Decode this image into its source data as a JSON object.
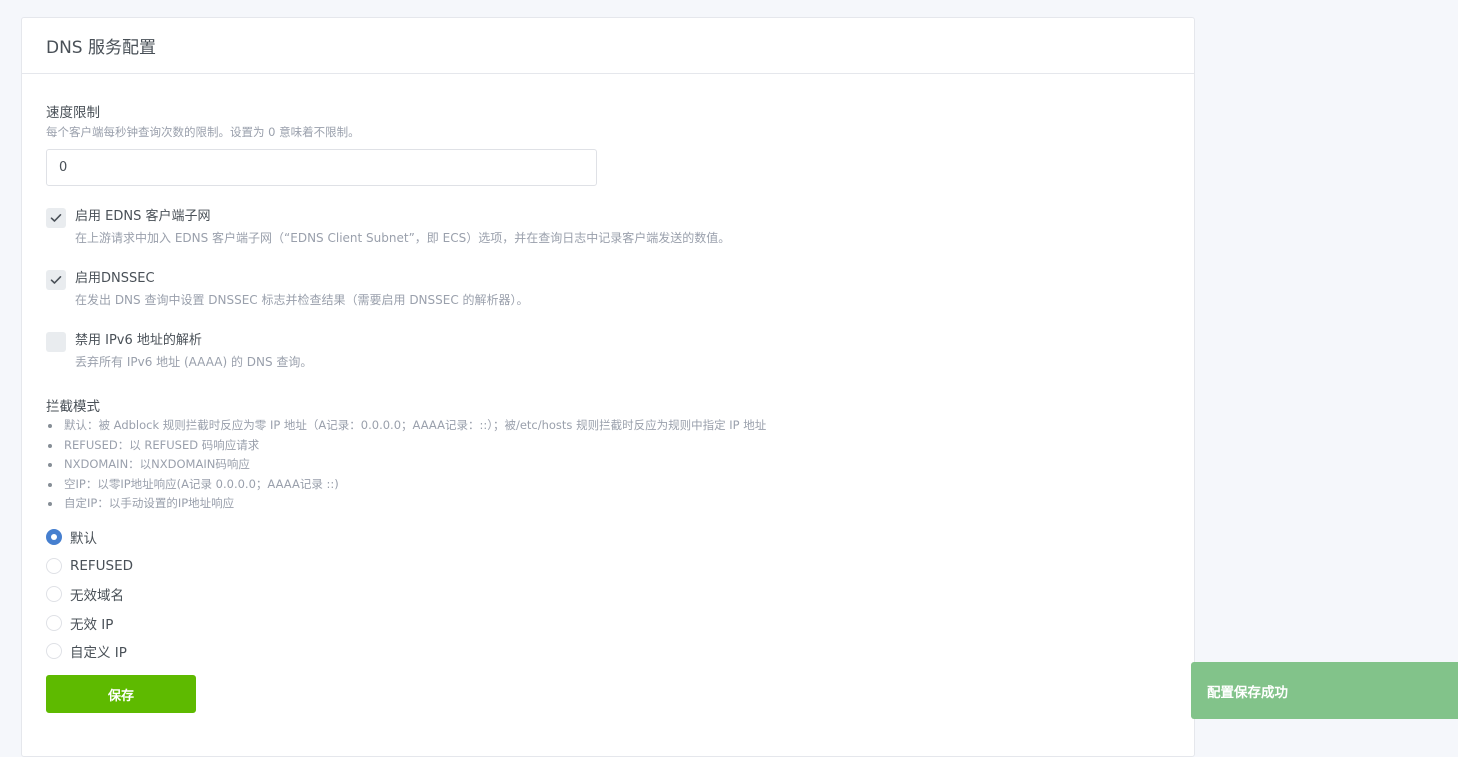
{
  "card": {
    "title": "DNS 服务配置"
  },
  "rate_limit": {
    "title": "速度限制",
    "description": "每个客户端每秒钟查询次数的限制。设置为 0 意味着不限制。",
    "value": "0"
  },
  "options": [
    {
      "label": "启用 EDNS 客户端子网",
      "description": "在上游请求中加入 EDNS 客户端子网（“EDNS Client Subnet”，即 ECS）选项，并在查询日志中记录客户端发送的数值。",
      "checked": true
    },
    {
      "label": "启用DNSSEC",
      "description": "在发出 DNS 查询中设置 DNSSEC 标志并检查结果（需要启用 DNSSEC 的解析器）。",
      "checked": true
    },
    {
      "label": "禁用 IPv6 地址的解析",
      "description": "丢弃所有 IPv6 地址 (AAAA) 的 DNS 查询。",
      "checked": false
    }
  ],
  "blocking_mode": {
    "title": "拦截模式",
    "bullets": [
      "默认：被 Adblock 规则拦截时反应为零 IP 地址（A记录：0.0.0.0；AAAA记录：::）；被/etc/hosts 规则拦截时反应为规则中指定 IP 地址",
      "REFUSED：以 REFUSED 码响应请求",
      "NXDOMAIN：以NXDOMAIN码响应",
      "空IP：以零IP地址响应(A记录 0.0.0.0；AAAA记录 ::)",
      "自定IP：以手动设置的IP地址响应"
    ],
    "options": [
      "默认",
      "REFUSED",
      "无效域名",
      "无效 IP",
      "自定义 IP"
    ],
    "selected_index": 0
  },
  "actions": {
    "save_label": "保存"
  },
  "toast": {
    "message": "配置保存成功"
  },
  "colors": {
    "accent_blue": "#467fcf",
    "save_green": "#5eba00",
    "toast_green": "#82c38a"
  }
}
